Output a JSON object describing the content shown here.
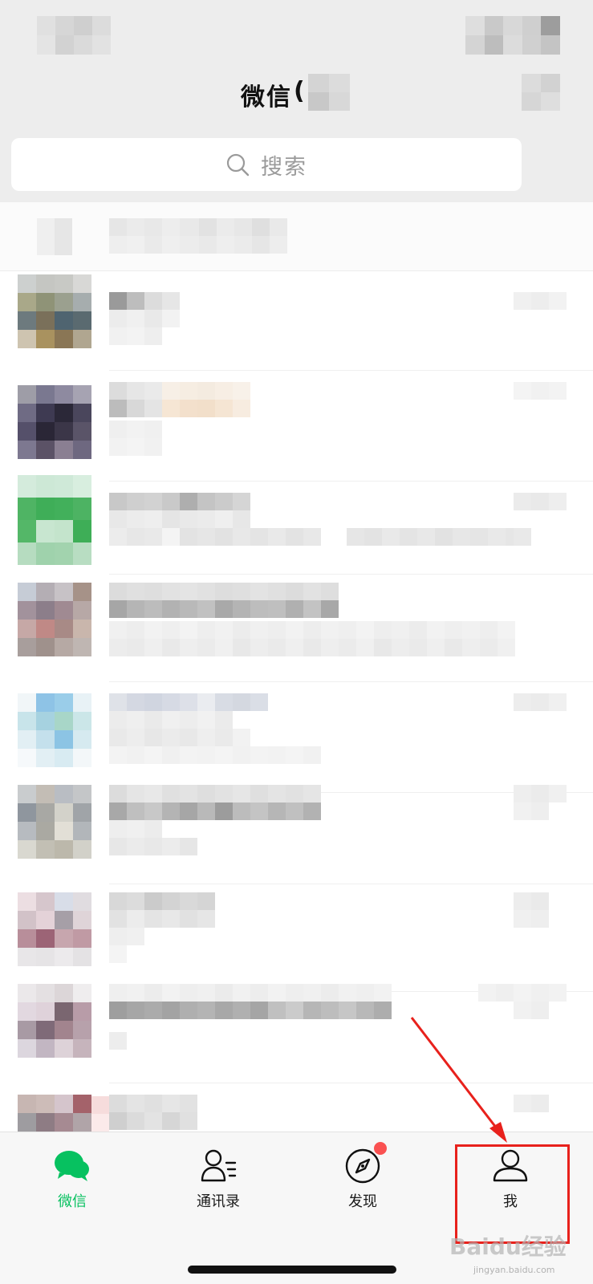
{
  "header": {
    "title": "微信",
    "title_paren": "("
  },
  "search": {
    "placeholder": "搜索"
  },
  "tabs": [
    {
      "label": "微信",
      "icon": "chat-bubbles-icon",
      "active": true
    },
    {
      "label": "通讯录",
      "icon": "contacts-icon",
      "active": false
    },
    {
      "label": "发现",
      "icon": "compass-icon",
      "active": false,
      "badge": true
    },
    {
      "label": "我",
      "icon": "person-icon",
      "active": false
    }
  ],
  "colors": {
    "accent": "#07c160",
    "badge": "#fa5151",
    "annotation": "#e8211c"
  },
  "watermark": {
    "text": "Baidu经验",
    "sub": "jingyan.baidu.com"
  }
}
